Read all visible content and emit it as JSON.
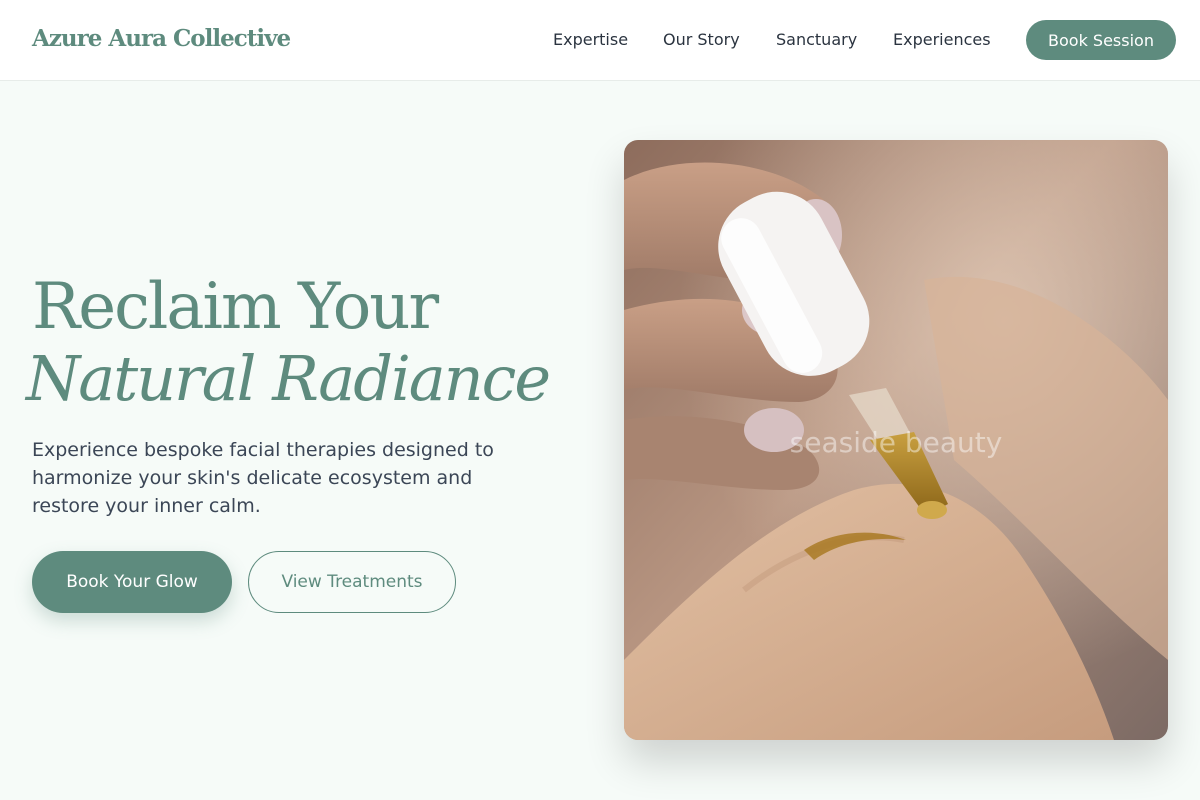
{
  "header": {
    "logo": "Azure Aura Collective",
    "nav": [
      "Expertise",
      "Our Story",
      "Sanctuary",
      "Experiences"
    ],
    "cta": "Book Session"
  },
  "hero": {
    "title_line1": "Reclaim Your",
    "title_line2": "Natural Radiance",
    "description": "Experience bespoke facial therapies designed to harmonize your skin's delicate ecosystem and restore your inner calm.",
    "primary_button": "Book Your Glow",
    "secondary_button": "View Treatments",
    "image_watermark": "seaside beauty"
  },
  "colors": {
    "accent": "#5e8b7e",
    "background": "#f6fbf8",
    "header_background": "#ffffff",
    "text_dark": "#2b3440"
  }
}
